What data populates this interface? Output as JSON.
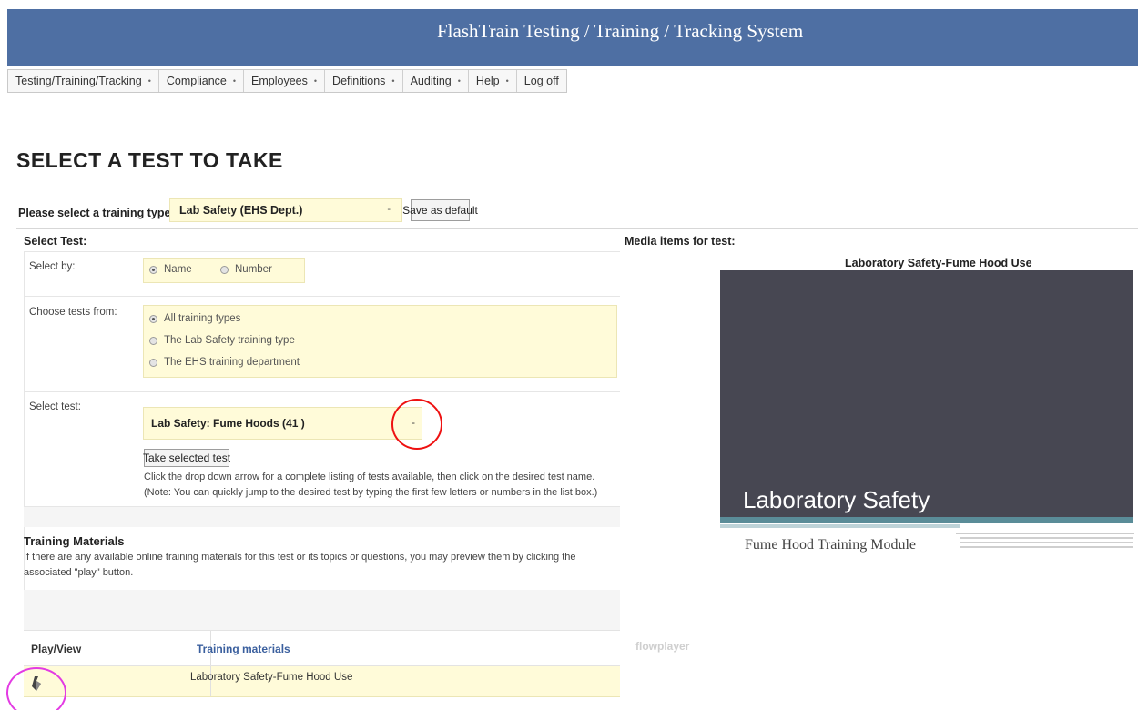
{
  "header": {
    "title": "FlashTrain Testing / Training / Tracking System"
  },
  "menu": [
    {
      "label": "Testing/Training/Tracking",
      "caret": "•"
    },
    {
      "label": "Compliance",
      "caret": "•"
    },
    {
      "label": "Employees",
      "caret": "•"
    },
    {
      "label": "Definitions",
      "caret": "•"
    },
    {
      "label": "Auditing",
      "caret": "•"
    },
    {
      "label": "Help",
      "caret": "•"
    },
    {
      "label": "Log off",
      "caret": ""
    }
  ],
  "page": {
    "title": "SELECT A TEST TO TAKE"
  },
  "training_type": {
    "label": "Please select a training type:",
    "value": "Lab Safety (EHS Dept.)",
    "arrow": "-",
    "save_default": "Save as default"
  },
  "select_test_section": {
    "heading": "Select Test:",
    "select_by_label": "Select by:",
    "select_by_options": [
      {
        "label": "Name",
        "checked": true
      },
      {
        "label": "Number",
        "checked": false
      }
    ],
    "choose_from_label": "Choose tests from:",
    "choose_from_options": [
      {
        "label": "All training types",
        "checked": true
      },
      {
        "label": "The Lab Safety training type",
        "checked": false
      },
      {
        "label": "The EHS training department",
        "checked": false
      }
    ],
    "select_test_label": "Select test:",
    "select_test_value": "Lab Safety: Fume Hoods (41 )",
    "select_test_arrow": "-",
    "take_button": "Take selected test",
    "help_line1": "Click the drop down arrow for a complete listing of tests available, then click on the desired test name.",
    "help_line2": "(Note: You can quickly jump to the desired test by typing the first few letters or numbers in the list box.)"
  },
  "training_materials": {
    "heading": "Training Materials",
    "description": "If there are any available online training materials for this test or its topics or questions, you may preview them by clicking the associated \"play\" button.",
    "col_play": "Play/View",
    "col_materials": "Training materials",
    "rows": [
      {
        "material": "Laboratory Safety-Fume Hood Use"
      }
    ]
  },
  "media": {
    "heading": "Media items for test:",
    "title": "Laboratory Safety-Fume Hood Use",
    "slide_heading": "Laboratory Safety",
    "slide_subtitle": "Fume Hood Training Module",
    "player_brand": "flowplayer"
  },
  "colors": {
    "header_bg": "#4e6fa3",
    "field_yellow": "#fffbd9",
    "slide_bg": "#474752",
    "annotation_red": "#e11111",
    "annotation_pink": "#e33be3"
  }
}
